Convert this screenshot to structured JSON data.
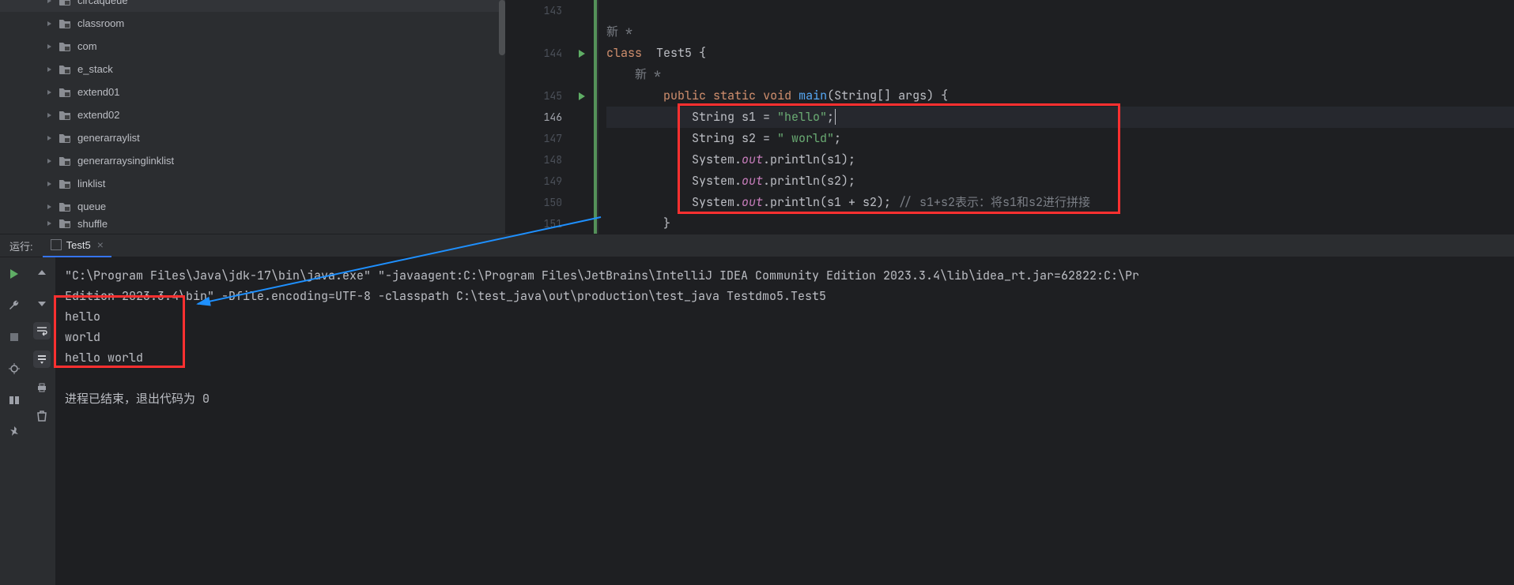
{
  "tree": [
    {
      "name": "circaqueue",
      "cut": true
    },
    {
      "name": "classroom"
    },
    {
      "name": "com"
    },
    {
      "name": "e_stack"
    },
    {
      "name": "extend01"
    },
    {
      "name": "extend02"
    },
    {
      "name": "generarraylist"
    },
    {
      "name": "generarraysinglinklist"
    },
    {
      "name": "linklist"
    },
    {
      "name": "queue"
    },
    {
      "name": "shuffle",
      "cut": true
    }
  ],
  "gutter": [
    "143",
    "144",
    "145",
    "146",
    "147",
    "148",
    "149",
    "150",
    "151"
  ],
  "active_line_index": 3,
  "code": {
    "annot_new": "新 *",
    "class_kw": "class",
    "class_name": "  Test5 {",
    "pub": "public",
    "stat": "static",
    "void": "void",
    "main_fn": "main",
    "main_sig": "(String[] args) {",
    "l146_a": "            String s1 = ",
    "l146_s": "\"hello\"",
    "l146_b": ";",
    "l147_a": "            String s2 = ",
    "l147_s": "\" world\"",
    "l147_b": ";",
    "l148_a": "            System.",
    "l148_out": "out",
    "l148_b": ".println(s1);",
    "l149_a": "            System.",
    "l149_out": "out",
    "l149_b": ".println(s2);",
    "l150_a": "            System.",
    "l150_out": "out",
    "l150_b": ".println(s1 + s2); ",
    "l150_c": "// s1+s2表示：将s1和s2进行拼接",
    "l151": "        }"
  },
  "run": {
    "label": "运行:",
    "tab": "Test5",
    "cmd1": "\"C:\\Program Files\\Java\\jdk-17\\bin\\java.exe\" \"-javaagent:C:\\Program Files\\JetBrains\\IntelliJ IDEA Community Edition 2023.3.4\\lib\\idea_rt.jar=62822:C:\\Pr",
    "cmd2": "   Edition 2023.3.4\\bin\" -Dfile.encoding=UTF-8 -classpath C:\\test_java\\out\\production\\test_java Testdmo5.Test5",
    "out1": "hello",
    "out2": " world",
    "out3": "hello world",
    "exit": "进程已结束，退出代码为 0"
  }
}
